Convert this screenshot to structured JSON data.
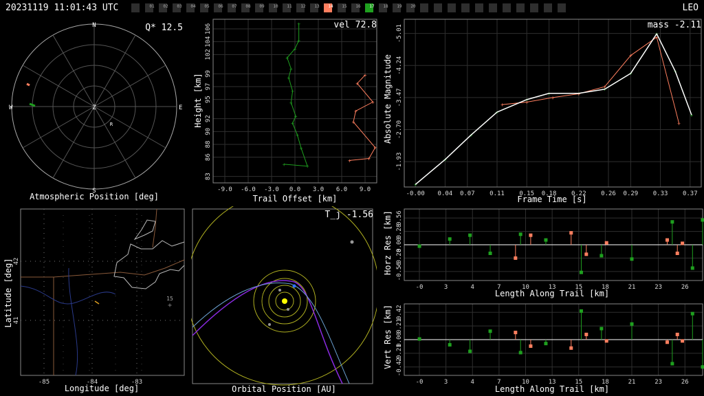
{
  "header": {
    "timestamp": "20231119 11:01:43 UTC",
    "orbit_class": "LEO"
  },
  "camera_strip": {
    "cells": [
      "",
      "01",
      "02",
      "03",
      "04",
      "05",
      "06",
      "07",
      "08",
      "09",
      "10",
      "11",
      "12",
      "13",
      "14",
      "15",
      "16",
      "17",
      "18",
      "19",
      "20",
      "",
      "",
      "",
      "",
      "",
      "",
      "",
      "",
      "",
      "",
      ""
    ],
    "highlight": {
      "14": "#ff7f5f",
      "17": "#1fa01f"
    }
  },
  "colors": {
    "green": "#1fa01f",
    "orange": "#ff7f5f",
    "grid": "#3a3a3a"
  },
  "chart_data": [
    {
      "id": "atmos",
      "type": "scatter",
      "xlabel": "Atmospheric Position [deg]",
      "annotation": "Q* 12.5",
      "directions": {
        "n": "N",
        "e": "E",
        "s": "S",
        "w": "W",
        "z": "Z",
        "r": "R"
      }
    },
    {
      "id": "height",
      "type": "line",
      "xlabel": "Trail Offset [km]",
      "ylabel": "Height [km]",
      "annotation": "vel 72.8",
      "xticks": [
        "-9.0",
        "-6.0",
        "-3.0",
        "0.0",
        "3.0",
        "6.0",
        "9.0"
      ],
      "yticks": [
        "83",
        "86",
        "88",
        "90",
        "92",
        "95",
        "97",
        "99",
        "102",
        "104",
        "106"
      ],
      "xlim": [
        -10.5,
        10.5
      ],
      "ylim": [
        82,
        107.5
      ],
      "series": [
        {
          "color": "green",
          "points": [
            [
              0.5,
              106.8
            ],
            [
              0.5,
              104.2
            ],
            [
              0.0,
              102.9
            ],
            [
              -1.0,
              101.5
            ],
            [
              -0.5,
              99.8
            ],
            [
              -0.8,
              98.4
            ],
            [
              -0.3,
              96.3
            ],
            [
              -0.5,
              94.5
            ],
            [
              0.1,
              92.4
            ],
            [
              -0.3,
              91.3
            ],
            [
              0.3,
              89.5
            ],
            [
              0.8,
              87.4
            ],
            [
              1.6,
              84.6
            ],
            [
              -1.4,
              84.9
            ]
          ]
        },
        {
          "color": "orange",
          "points": [
            [
              9.0,
              98.8
            ],
            [
              8.0,
              97.5
            ],
            [
              10.0,
              94.6
            ],
            [
              7.8,
              93.2
            ],
            [
              7.5,
              91.5
            ],
            [
              10.3,
              87.5
            ],
            [
              9.5,
              85.8
            ],
            [
              7.0,
              85.5
            ]
          ]
        }
      ]
    },
    {
      "id": "mag",
      "type": "line",
      "xlabel": "Frame Time [s]",
      "ylabel": "Absolute Magnitude",
      "annotation": "mass -2.11",
      "xticks": [
        "-0.00",
        "0.04",
        "0.07",
        "0.11",
        "0.15",
        "0.18",
        "0.22",
        "0.26",
        "0.29",
        "0.33",
        "0.37"
      ],
      "yticks": [
        "-5.01",
        "-4.24",
        "-3.47",
        "-2.70",
        "-1.93"
      ],
      "xlim": [
        -0.015,
        0.385
      ],
      "ylim": [
        -1.32,
        -5.35
      ],
      "series": [
        {
          "color": "green",
          "points": [
            [
              0.0,
              -1.38
            ],
            [
              0.04,
              -1.98
            ],
            [
              0.075,
              -2.57
            ],
            [
              0.11,
              -3.12
            ],
            [
              0.15,
              -3.42
            ],
            [
              0.18,
              -3.57
            ],
            [
              0.22,
              -3.57
            ],
            [
              0.255,
              -3.67
            ],
            [
              0.29,
              -4.05
            ],
            [
              0.325,
              -5.0
            ],
            [
              0.35,
              -4.1
            ],
            [
              0.372,
              -3.05
            ]
          ]
        },
        {
          "color": "orange",
          "points": [
            [
              0.117,
              -3.3
            ],
            [
              0.15,
              -3.36
            ],
            [
              0.185,
              -3.47
            ],
            [
              0.22,
              -3.56
            ],
            [
              0.255,
              -3.73
            ],
            [
              0.29,
              -4.48
            ],
            [
              0.325,
              -4.92
            ],
            [
              0.355,
              -2.85
            ]
          ]
        }
      ]
    },
    {
      "id": "map",
      "type": "scatter",
      "xlabel": "Longitude [deg]",
      "ylabel": "Latitude [deg]",
      "xticks": [
        "-85",
        "-84",
        "-83"
      ],
      "yticks": [
        "42",
        "41"
      ],
      "station_label": "15"
    },
    {
      "id": "orbit",
      "type": "scatter",
      "xlabel": "Orbital Position [AU]",
      "annotation": "T_j -1.56"
    },
    {
      "id": "horz",
      "type": "scatter",
      "xlabel": "Length Along Trail [km]",
      "ylabel": "Horz Res [km]",
      "xticks": [
        "-0",
        "3",
        "4",
        "7",
        "10",
        "13",
        "15",
        "18",
        "21",
        "23",
        "26"
      ],
      "yticks": [
        "0.56",
        "0.28",
        "0.00",
        "-0.28",
        "-0.56"
      ],
      "xlim": [
        -1.5,
        28
      ],
      "ylim": [
        -0.75,
        0.75
      ],
      "series": [
        {
          "color": "green",
          "points": [
            [
              0,
              -0.03
            ],
            [
              3,
              0.12
            ],
            [
              5,
              0.2
            ],
            [
              7,
              -0.18
            ],
            [
              10,
              0.22
            ],
            [
              12.5,
              0.1
            ],
            [
              16,
              -0.58
            ],
            [
              18,
              -0.23
            ],
            [
              21,
              -0.3
            ],
            [
              25,
              0.48
            ],
            [
              27,
              -0.49
            ],
            [
              28,
              0.52
            ]
          ]
        },
        {
          "color": "orange",
          "points": [
            [
              9.5,
              -0.28
            ],
            [
              11,
              0.2
            ],
            [
              15,
              0.25
            ],
            [
              16.5,
              -0.2
            ],
            [
              18.5,
              0.04
            ],
            [
              24.5,
              0.1
            ],
            [
              25.5,
              -0.18
            ],
            [
              26,
              0.03
            ]
          ]
        }
      ]
    },
    {
      "id": "vert",
      "type": "scatter",
      "xlabel": "Length Along Trail [km]",
      "ylabel": "Vert Res [km]",
      "xticks": [
        "-0",
        "3",
        "4",
        "7",
        "10",
        "13",
        "15",
        "18",
        "21",
        "23",
        "26"
      ],
      "yticks": [
        "0.42",
        "0.21",
        "0.00",
        "-0.21",
        "-0.42"
      ],
      "xlim": [
        -1.5,
        28
      ],
      "ylim": [
        -0.55,
        0.55
      ],
      "series": [
        {
          "color": "green",
          "points": [
            [
              0,
              0.01
            ],
            [
              3,
              -0.08
            ],
            [
              5,
              -0.18
            ],
            [
              7,
              0.13
            ],
            [
              10,
              -0.2
            ],
            [
              12.5,
              -0.06
            ],
            [
              16,
              0.44
            ],
            [
              18,
              0.17
            ],
            [
              21,
              0.24
            ],
            [
              25,
              -0.37
            ],
            [
              27,
              0.4
            ],
            [
              28,
              -0.42
            ]
          ]
        },
        {
          "color": "orange",
          "points": [
            [
              9.5,
              0.11
            ],
            [
              11,
              -0.1
            ],
            [
              15,
              -0.13
            ],
            [
              16.5,
              0.08
            ],
            [
              18.5,
              -0.02
            ],
            [
              24.5,
              -0.04
            ],
            [
              25.5,
              0.08
            ],
            [
              26,
              -0.02
            ]
          ]
        }
      ]
    }
  ]
}
